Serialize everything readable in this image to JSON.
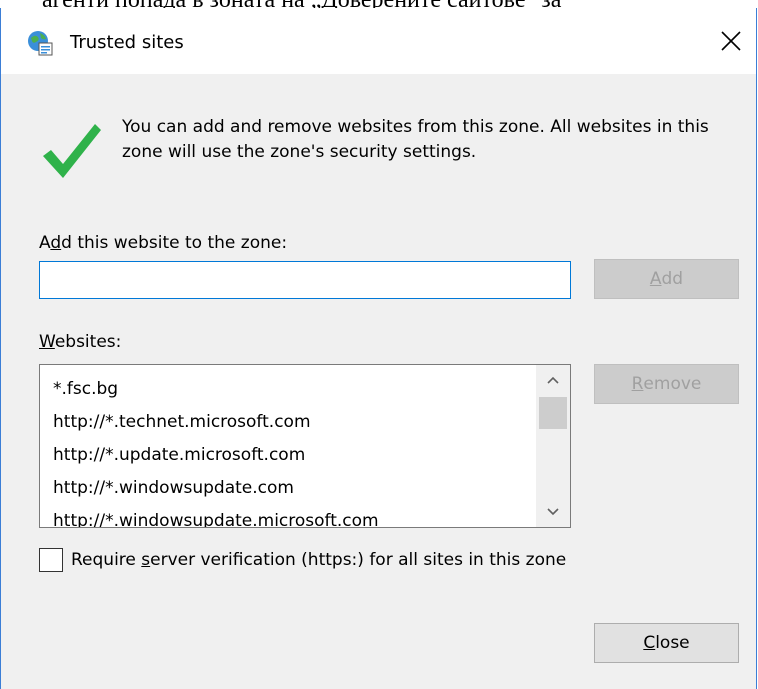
{
  "background_text": "агенти  попада в зоната на „Доверените сайтове\" за",
  "window": {
    "title": "Trusted sites",
    "title_icon": "globe-trusted-sites-icon",
    "close_icon": "close-icon"
  },
  "intro": {
    "icon": "green-checkmark-icon",
    "text": "You can add and remove websites from this zone. All websites in this zone will use the zone's security settings."
  },
  "add_section": {
    "label_prefix": "A",
    "label_mnemonic": "d",
    "label_rest": "d this website to the zone:",
    "input_value": "",
    "add_button_mnemonic": "A",
    "add_button_rest": "dd"
  },
  "websites_section": {
    "label_mnemonic": "W",
    "label_rest": "ebsites:",
    "items": [
      "*.fsc.bg",
      "http://*.technet.microsoft.com",
      "http://*.update.microsoft.com",
      "http://*.windowsupdate.com",
      "http://*.windowsupdate.microsoft.com"
    ],
    "remove_button_mnemonic": "R",
    "remove_button_rest": "emove"
  },
  "require_https": {
    "checked": false,
    "label_prefix": "Require ",
    "label_mnemonic": "s",
    "label_rest": "erver verification (https:) for all sites in this zone"
  },
  "footer": {
    "close_mnemonic": "C",
    "close_rest": "lose"
  },
  "colors": {
    "dialog_bg": "#f0f0f0",
    "accent_border": "#0078d7",
    "check_green": "#2fb24a"
  }
}
